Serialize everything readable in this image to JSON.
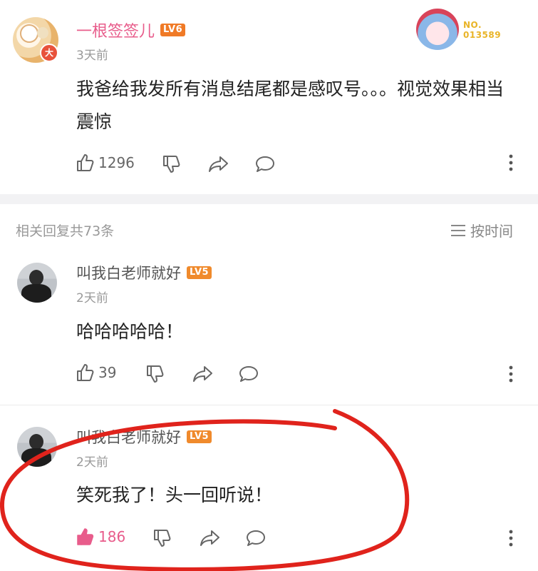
{
  "main_comment": {
    "avatar_badge": "大",
    "username": "一根签签儿",
    "level": "LV6",
    "time": "3天前",
    "text": "我爸给我发所有消息结尾都是感叹号。。。视觉效果相当震惊",
    "likes": "1296",
    "fan_badge": {
      "label": "NO.",
      "number": "013589"
    }
  },
  "replies_header": {
    "count_text": "相关回复共73条",
    "sort_label": "按时间"
  },
  "replies": [
    {
      "username": "叫我白老师就好",
      "level": "LV5",
      "time": "2天前",
      "text": "哈哈哈哈哈！",
      "likes": "39",
      "liked": false
    },
    {
      "username": "叫我白老师就好",
      "level": "LV5",
      "time": "2天前",
      "text": "笑死我了！头一回听说！",
      "likes": "186",
      "liked": true
    }
  ],
  "colors": {
    "username_pink": "#e85c8b",
    "liked_pink": "#e85c8b",
    "level_orange": "#f07a26",
    "circle_red": "#e0231c"
  }
}
